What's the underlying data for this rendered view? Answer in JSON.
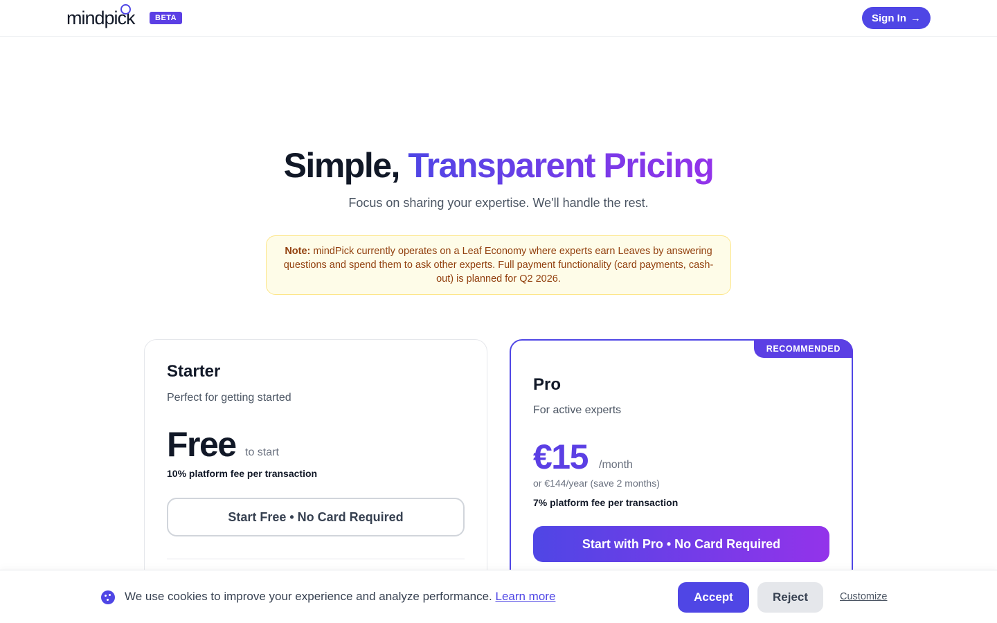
{
  "header": {
    "logo_text": "mindpick",
    "beta_badge": "BETA",
    "signin_label": "Sign In",
    "signin_icon": "arrow-right-icon"
  },
  "hero": {
    "title_plain": "Simple,",
    "title_accent": "Transparent Pricing",
    "subtitle": "Focus on sharing your expertise. We'll handle the rest."
  },
  "note": {
    "label": "Note:",
    "text": "mindPick currently operates on a Leaf Economy where experts earn Leaves by answering questions and spend them to ask other experts. Full payment functionality (card payments, cash-out) is planned for Q2 2026."
  },
  "plans": {
    "starter": {
      "name": "Starter",
      "description": "Perfect for getting started",
      "price": "Free",
      "price_suffix": "to start",
      "fee": "10% platform fee per transaction",
      "cta": "Start Free • No Card Required"
    },
    "pro": {
      "badge": "RECOMMENDED",
      "name": "Pro",
      "description": "For active experts",
      "price": "€15",
      "price_suffix": "/month",
      "price_alt": "or €144/year (save 2 months)",
      "fee": "7% platform fee per transaction",
      "cta": "Start with Pro • No Card Required"
    }
  },
  "cookie": {
    "icon": "cookie-icon",
    "text": "We use cookies to improve your experience and analyze performance.",
    "learn_more": "Learn more",
    "accept": "Accept",
    "reject": "Reject",
    "customize": "Customize"
  },
  "colors": {
    "accent": "#4f46e5",
    "accent_gradient_end": "#9333ea",
    "note_bg": "#fefce8",
    "note_text": "#92400e"
  }
}
